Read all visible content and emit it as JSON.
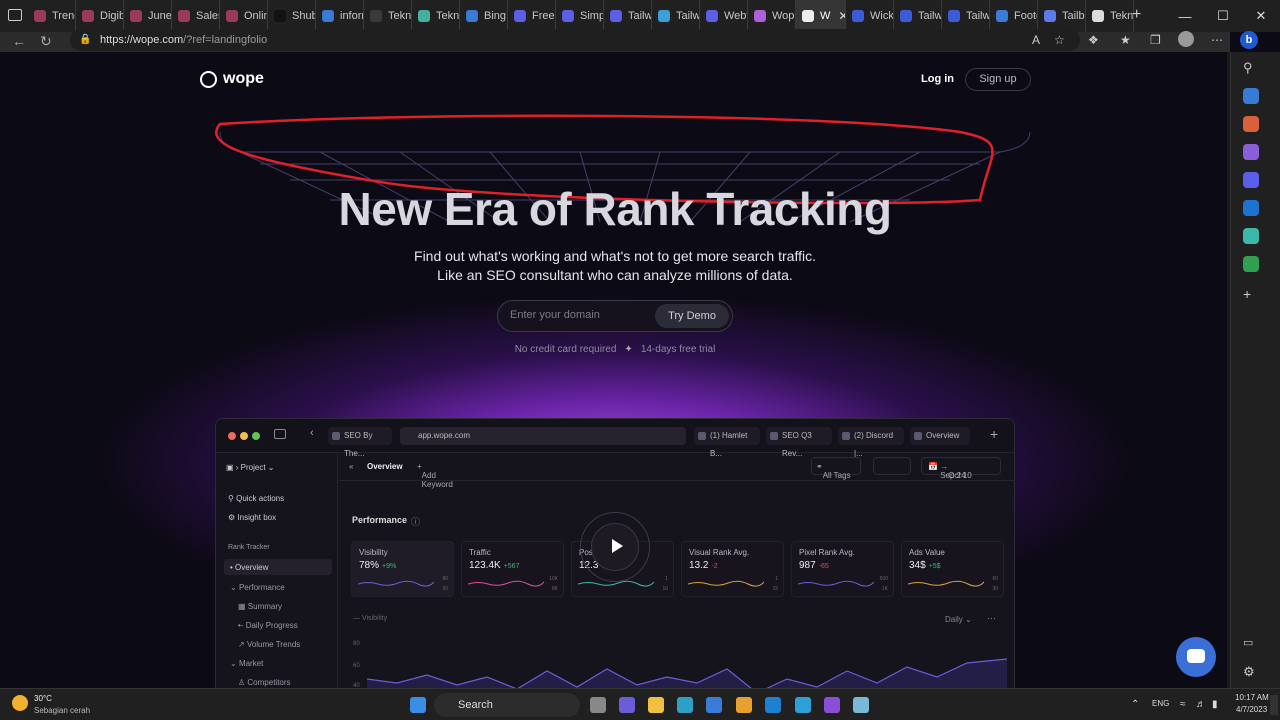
{
  "browser": {
    "tabs": [
      {
        "label": "Trendi",
        "color": "#9b3b5c",
        "active": false
      },
      {
        "label": "Digibc",
        "color": "#9b3b5c",
        "active": false
      },
      {
        "label": "June #",
        "color": "#9b3b5c",
        "active": false
      },
      {
        "label": "Sales #",
        "color": "#9b3b5c",
        "active": false
      },
      {
        "label": "Online",
        "color": "#9b3b5c",
        "active": false
      },
      {
        "label": "Shubh",
        "color": "#111111",
        "active": false
      },
      {
        "label": "inform",
        "color": "#3b7bd8",
        "active": false
      },
      {
        "label": "Teknik",
        "color": "#3a3a3a",
        "active": false
      },
      {
        "label": "Teknik",
        "color": "#46b0a0",
        "active": false
      },
      {
        "label": "Bing A",
        "color": "#3b7bd8",
        "active": false
      },
      {
        "label": "Free T",
        "color": "#5b5ee8",
        "active": false
      },
      {
        "label": "Simpl",
        "color": "#5b5ee8",
        "active": false
      },
      {
        "label": "Tailwi",
        "color": "#5b5ee8",
        "active": false
      },
      {
        "label": "Tailwi",
        "color": "#3ba0d8",
        "active": false
      },
      {
        "label": "Webfl",
        "color": "#5b5ee8",
        "active": false
      },
      {
        "label": "Wope",
        "color": "#b060d8",
        "active": false
      },
      {
        "label": "W",
        "color": "#eeeeee",
        "active": true
      },
      {
        "label": "Wicke",
        "color": "#3b5bd8",
        "active": false
      },
      {
        "label": "Tailwi",
        "color": "#3b5bd8",
        "active": false
      },
      {
        "label": "Tailwi",
        "color": "#3b5bd8",
        "active": false
      },
      {
        "label": "Foote",
        "color": "#3b7bd8",
        "active": false
      },
      {
        "label": "Tailblo",
        "color": "#5b7be8",
        "active": false
      },
      {
        "label": "Teknik",
        "color": "#dddddd",
        "active": false
      }
    ],
    "url_main": "https://wope.com",
    "url_rest": "/?ref=landingfolio"
  },
  "site": {
    "logo_text": "wope",
    "login": "Log in",
    "signup": "Sign up",
    "headline": "New Era of Rank Tracking",
    "sub1": "Find out what's working and what's not to get more search traffic.",
    "sub2": "Like an SEO consultant who can analyze millions of data.",
    "domain_placeholder": "Enter your domain",
    "try_demo": "Try Demo",
    "note1": "No credit card required",
    "note2": "14-days free trial"
  },
  "app": {
    "tabs": [
      "SEO By The...",
      "(1) Hamlet B...",
      "SEO Q3 Rev...",
      "(2) Discord |...",
      "Overview"
    ],
    "url": "app.wope.com",
    "project": "Project",
    "sidebar": {
      "quick_actions": "Quick actions",
      "insight_box": "Insight box",
      "section": "Rank Tracker",
      "overview": "Overview",
      "performance": "Performance",
      "summary": "Summary",
      "daily_progress": "Daily Progress",
      "volume_trends": "Volume Trends",
      "market": "Market",
      "competitors": "Competitors"
    },
    "header": {
      "title": "Overview",
      "add_keyword": "Add Keyword",
      "all_tags": "All Tags",
      "date_from": "Sep 24",
      "date_to": "Oct 10"
    },
    "performance_title": "Performance",
    "metrics": [
      {
        "title": "Visibility",
        "value": "78%",
        "delta": "+9%",
        "up": true,
        "r1": "80",
        "r2": "20",
        "color": "#6a5ed8"
      },
      {
        "title": "Traffic",
        "value": "123.4K",
        "delta": "+567",
        "up": true,
        "r1": "10K",
        "r2": "8K",
        "color": "#d84f9a"
      },
      {
        "title": "Position Avg.",
        "value": "12.3",
        "delta": "+4.5",
        "up": true,
        "r1": "1",
        "r2": "10",
        "color": "#3fb8a8"
      },
      {
        "title": "Visual Rank Avg.",
        "value": "13.2",
        "delta": "-2",
        "up": false,
        "r1": "1",
        "r2": "15",
        "color": "#d8a33f"
      },
      {
        "title": "Pixel Rank Avg.",
        "value": "987",
        "delta": "-65",
        "up": false,
        "r1": "500",
        "r2": "1K",
        "color": "#6a5ed8"
      },
      {
        "title": "Ads Value",
        "value": "34$",
        "delta": "+5$",
        "up": true,
        "r1": "60",
        "r2": "30",
        "color": "#d8a33f"
      }
    ],
    "chart_label": "Visibility",
    "chart_period": "Daily",
    "chart_ticks": [
      "80",
      "60",
      "40"
    ]
  },
  "taskbar": {
    "weather_temp": "30°C",
    "weather_desc": "Sebagian cerah",
    "search": "Search",
    "lang": "ENG",
    "time": "10:17 AM",
    "date": "4/7/2023"
  }
}
